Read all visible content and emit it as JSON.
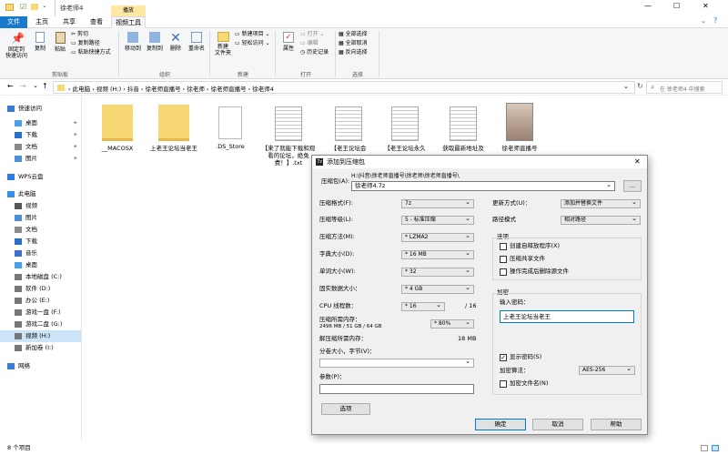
{
  "window": {
    "title": "徐老师4",
    "min": "—",
    "max": "☐",
    "close": "✕"
  },
  "ribbon_tabs": {
    "file": "文件",
    "home": "主页",
    "share": "共享",
    "view": "查看",
    "manage": "视频工具",
    "play": "播放"
  },
  "ribbon": {
    "pin": "固定到\n快速访问",
    "copy": "复制",
    "paste": "粘贴",
    "cut": "剪切",
    "copy_path": "复制路径",
    "paste_shortcut": "粘贴快捷方式",
    "g_clipboard": "剪贴板",
    "move_to": "移动到",
    "copy_to": "复制到",
    "delete": "删除",
    "rename": "重命名",
    "g_organize": "组织",
    "new_folder": "新建\n文件夹",
    "new_item": "新建项目",
    "easy_access": "轻松访问",
    "g_new": "新建",
    "properties": "属性",
    "open": "打开",
    "edit": "编辑",
    "history": "历史记录",
    "g_open": "打开",
    "select_all": "全部选择",
    "select_none": "全部取消",
    "invert": "反向选择",
    "g_select": "选择"
  },
  "address": {
    "crumbs": [
      "此电脑",
      "视频 (H:)",
      "抖音",
      "徐老师直播号",
      "徐老师",
      "徐老师直播号",
      "徐老师4"
    ],
    "search_placeholder": "在 徐老师4 中搜索"
  },
  "sidebar": [
    {
      "label": "快速访问",
      "icon": "star-icon",
      "color": "#3a7bd5",
      "pin": false
    },
    {
      "label": "桌面",
      "icon": "desktop-icon",
      "color": "#4aa0e6",
      "pin": true
    },
    {
      "label": "下载",
      "icon": "download-icon",
      "color": "#2a6fc9",
      "pin": true
    },
    {
      "label": "文档",
      "icon": "document-icon",
      "color": "#8a8a8a",
      "pin": true
    },
    {
      "label": "图片",
      "icon": "picture-icon",
      "color": "#4a90d9",
      "pin": true
    },
    {
      "label": "WPS云盘",
      "icon": "cloud-icon",
      "color": "#2a7be4",
      "pin": false
    },
    {
      "label": "此电脑",
      "icon": "pc-icon",
      "color": "#3a8ee6",
      "pin": false
    },
    {
      "label": "视频",
      "icon": "video-icon",
      "color": "#555",
      "pin": false
    },
    {
      "label": "图片",
      "icon": "picture-icon",
      "color": "#4a90d9",
      "pin": false
    },
    {
      "label": "文档",
      "icon": "document-icon",
      "color": "#8a8a8a",
      "pin": false
    },
    {
      "label": "下载",
      "icon": "download-icon",
      "color": "#2a6fc9",
      "pin": false
    },
    {
      "label": "音乐",
      "icon": "music-icon",
      "color": "#3a6fd0",
      "pin": false
    },
    {
      "label": "桌面",
      "icon": "desktop-icon",
      "color": "#4aa0e6",
      "pin": false
    },
    {
      "label": "本地磁盘 (C:)",
      "icon": "drive-icon",
      "color": "#777",
      "pin": false
    },
    {
      "label": "软件 (D:)",
      "icon": "drive-icon",
      "color": "#777",
      "pin": false
    },
    {
      "label": "办公 (E:)",
      "icon": "drive-icon",
      "color": "#777",
      "pin": false
    },
    {
      "label": "游戏一盘 (F:)",
      "icon": "drive-icon",
      "color": "#777",
      "pin": false
    },
    {
      "label": "游戏二盘 (G:)",
      "icon": "drive-icon",
      "color": "#777",
      "pin": false
    },
    {
      "label": "视频 (H:)",
      "icon": "drive-icon",
      "color": "#777",
      "pin": false
    },
    {
      "label": "新加卷 (I:)",
      "icon": "drive-icon",
      "color": "#777",
      "pin": false
    },
    {
      "label": "网络",
      "icon": "network-icon",
      "color": "#3a7bd5",
      "pin": false
    }
  ],
  "files": [
    {
      "name": "__MACOSX",
      "type": "folder"
    },
    {
      "name": "上老王论坛当老王",
      "type": "folder"
    },
    {
      "name": ".DS_Store",
      "type": "blank"
    },
    {
      "name": "【来了就能下载和观看的论坛，绝免费！】.txt",
      "type": "text"
    },
    {
      "name": "【老王论坛会",
      "type": "text"
    },
    {
      "name": "【老王论坛永久",
      "type": "text"
    },
    {
      "name": "获取最新地址及",
      "type": "text"
    },
    {
      "name": "徐老师直播号",
      "type": "video"
    }
  ],
  "status": {
    "count": "8 个项目"
  },
  "dialog": {
    "title": "添加到压缩包",
    "archive_label": "压缩包(A):",
    "archive_path": "H:\\抖音\\徐老师直播号\\徐老师\\徐老师直播号\\",
    "archive_name": "徐老师4.7z",
    "browse": "...",
    "format_label": "压缩格式(F):",
    "format": "7z",
    "level_label": "压缩等级(L):",
    "level": "5 - 标准压缩",
    "method_label": "压缩方法(M):",
    "method": "* LZMA2",
    "dict_label": "字典大小(D):",
    "dict": "* 16 MB",
    "word_label": "单词大小(W):",
    "word": "* 32",
    "solid_label": "固实数据大小：",
    "solid": "* 4 GB",
    "cpu_label": "CPU 线程数：",
    "cpu": "* 16",
    "cpu_total": "/ 16",
    "mem_label": "压缩所需内存：",
    "mem_detail": "2496 MB / 51 GB / 64 GB",
    "mem_pct": "* 80%",
    "decomp_label": "解压缩所需内存：",
    "decomp_value": "18 MB",
    "split_label": "分卷大小，字节(V)：",
    "params_label": "参数(P)：",
    "options_btn": "选项",
    "update_label": "更新方式(U)：",
    "update": "添加并替换文件",
    "path_label": "路径模式",
    "path": "相对路径",
    "options_group": "选项",
    "sfx": "创建自释放程序(X)",
    "shared": "压缩共享文件",
    "delete_after": "操作完成后删除源文件",
    "encrypt_group": "加密",
    "pwd_label": "输入密码：",
    "password": "上老王论坛当老王",
    "show_pwd": "显示密码(S)",
    "enc_method_label": "加密算法：",
    "enc_method": "AES-256",
    "enc_names": "加密文件名(N)",
    "ok": "确定",
    "cancel": "取消",
    "help": "帮助"
  },
  "colors": {
    "accent": "#1979ca",
    "folder": "#f8d775",
    "folder_dark": "#e5b84a",
    "play_tab": "#ffe8a6",
    "pwd_border": "#0078d7"
  }
}
